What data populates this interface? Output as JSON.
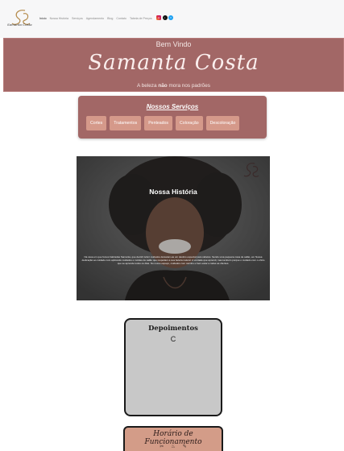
{
  "header": {
    "logo_text": "Samanta Costa",
    "nav": [
      "Início",
      "Nossa História",
      "Serviços",
      "Agendamento",
      "Blog",
      "Contato",
      "Tabela de Preços"
    ],
    "social": [
      {
        "icon": "instagram-icon",
        "color": "#dc2743"
      },
      {
        "icon": "tiktok-icon",
        "color": "#111111"
      },
      {
        "icon": "twitter-icon",
        "color": "#1da1f2"
      }
    ]
  },
  "hero": {
    "welcome": "Bem Vindo",
    "name": "Samanta Costa",
    "tagline_before": "A beleza ",
    "tagline_bold": "não",
    "tagline_after": " mora nos padrões",
    "bg_color": "#a26766"
  },
  "services": {
    "title": "Nossos Serviços",
    "items": [
      "Cortes",
      "Tratamentos",
      "Penteados",
      "Coloração",
      "Descoloração"
    ]
  },
  "history": {
    "title": "Nossa História",
    "text": "Na casa em que fomos batizadas Samanta, que decidi incluir cuidados deixaram-as um destino especial para cabelos. Sendo uma pequena casa de salão, em Nossa dedicação ao cuidado com aplicando cuidados e moldes de salão que respeitam a sua beleza natural. A verdade que aprendi, mas também porque o cuidado com o ofício que se aprende todos os dias. No nosso espaço, cuidados com carinho e bem-estar a todas as clientes."
  },
  "testimonials": {
    "title": "Depoimentos",
    "letter": "C"
  },
  "hours": {
    "title": "Horário de Funcionamento",
    "icons": [
      "scissors-icon",
      "dryer-icon",
      "comb-icon"
    ]
  }
}
